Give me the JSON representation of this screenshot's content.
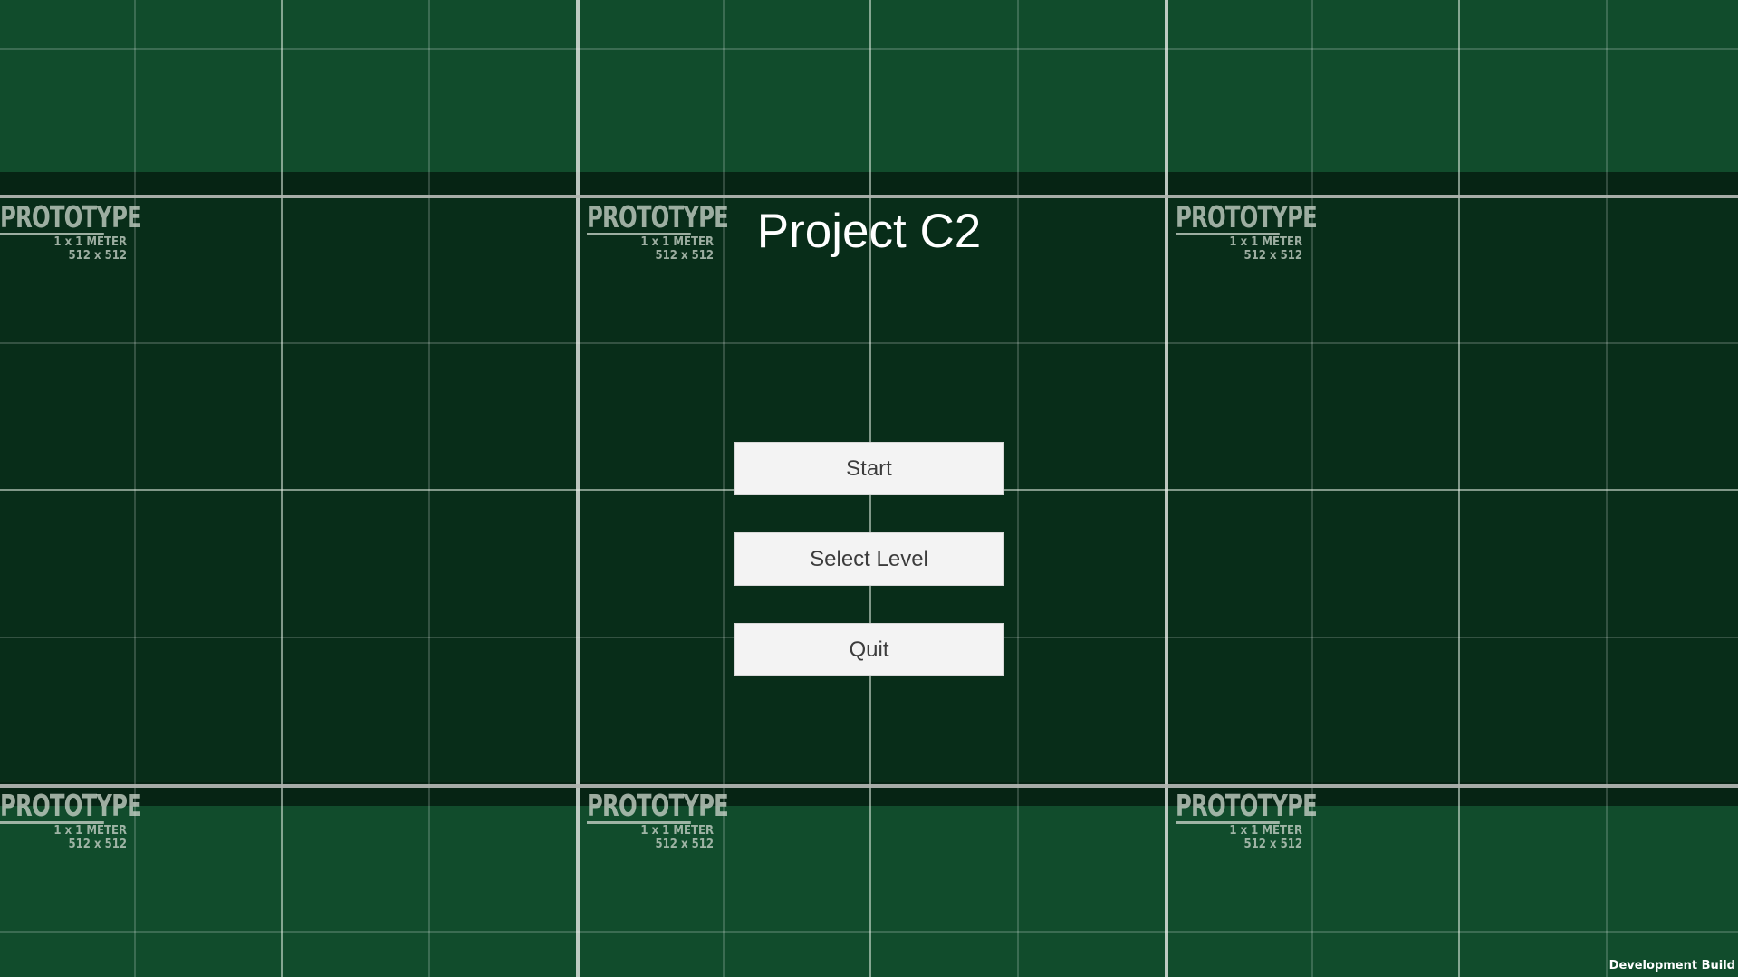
{
  "title": "Project C2",
  "menu": {
    "start_label": "Start",
    "select_level_label": "Select Level",
    "quit_label": "Quit"
  },
  "prototype_tile": {
    "word": "PROTOTYPE",
    "size_label": "1 x 1 METER",
    "resolution_label": "512 x 512"
  },
  "footer": {
    "build_label": "Development Build"
  },
  "colors": {
    "ground_green": "#114c2c",
    "dark_band": "#082d19",
    "button_bg": "#f3f3f3",
    "button_text": "#3c3c3c",
    "title_text": "#ffffff"
  }
}
